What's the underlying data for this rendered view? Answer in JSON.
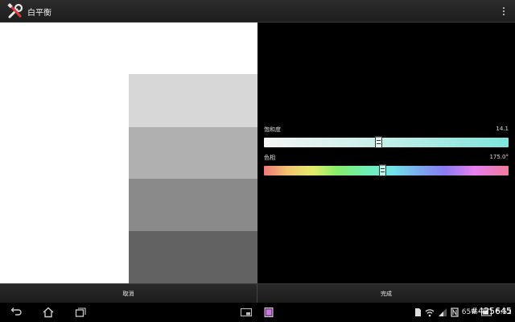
{
  "app": {
    "title": "白平衡",
    "icon": "tools-icon"
  },
  "menu": {
    "icon": "overflow-menu-icon"
  },
  "preview": {
    "background": "#ffffff",
    "swatches": [
      "#d7d7d7",
      "#b0b0b0",
      "#8a8a8a",
      "#626262"
    ]
  },
  "controls": {
    "saturation": {
      "label": "饱和度",
      "value_text": "14.1",
      "fraction": 0.47
    },
    "hue": {
      "label": "色相",
      "value_text": "175.0°",
      "fraction": 0.485
    }
  },
  "buttons": {
    "cancel_label": "取消",
    "done_label": "完成"
  },
  "system_bar": {
    "nav_icons": [
      "back-icon",
      "home-icon",
      "recent-apps-icon"
    ],
    "small_app_icons": [
      "small-app-icon",
      "screen-capture-icon"
    ],
    "status_icons": [
      "sim-icon",
      "wifi-icon",
      "signal-icon",
      "nfc-icon",
      "battery-icon"
    ],
    "battery_text": "65%",
    "clock_text": "6:52",
    "watermark": "#425645"
  },
  "colors": {
    "accent_cyan": "#7ee6dc",
    "bar_background": "#222222"
  }
}
